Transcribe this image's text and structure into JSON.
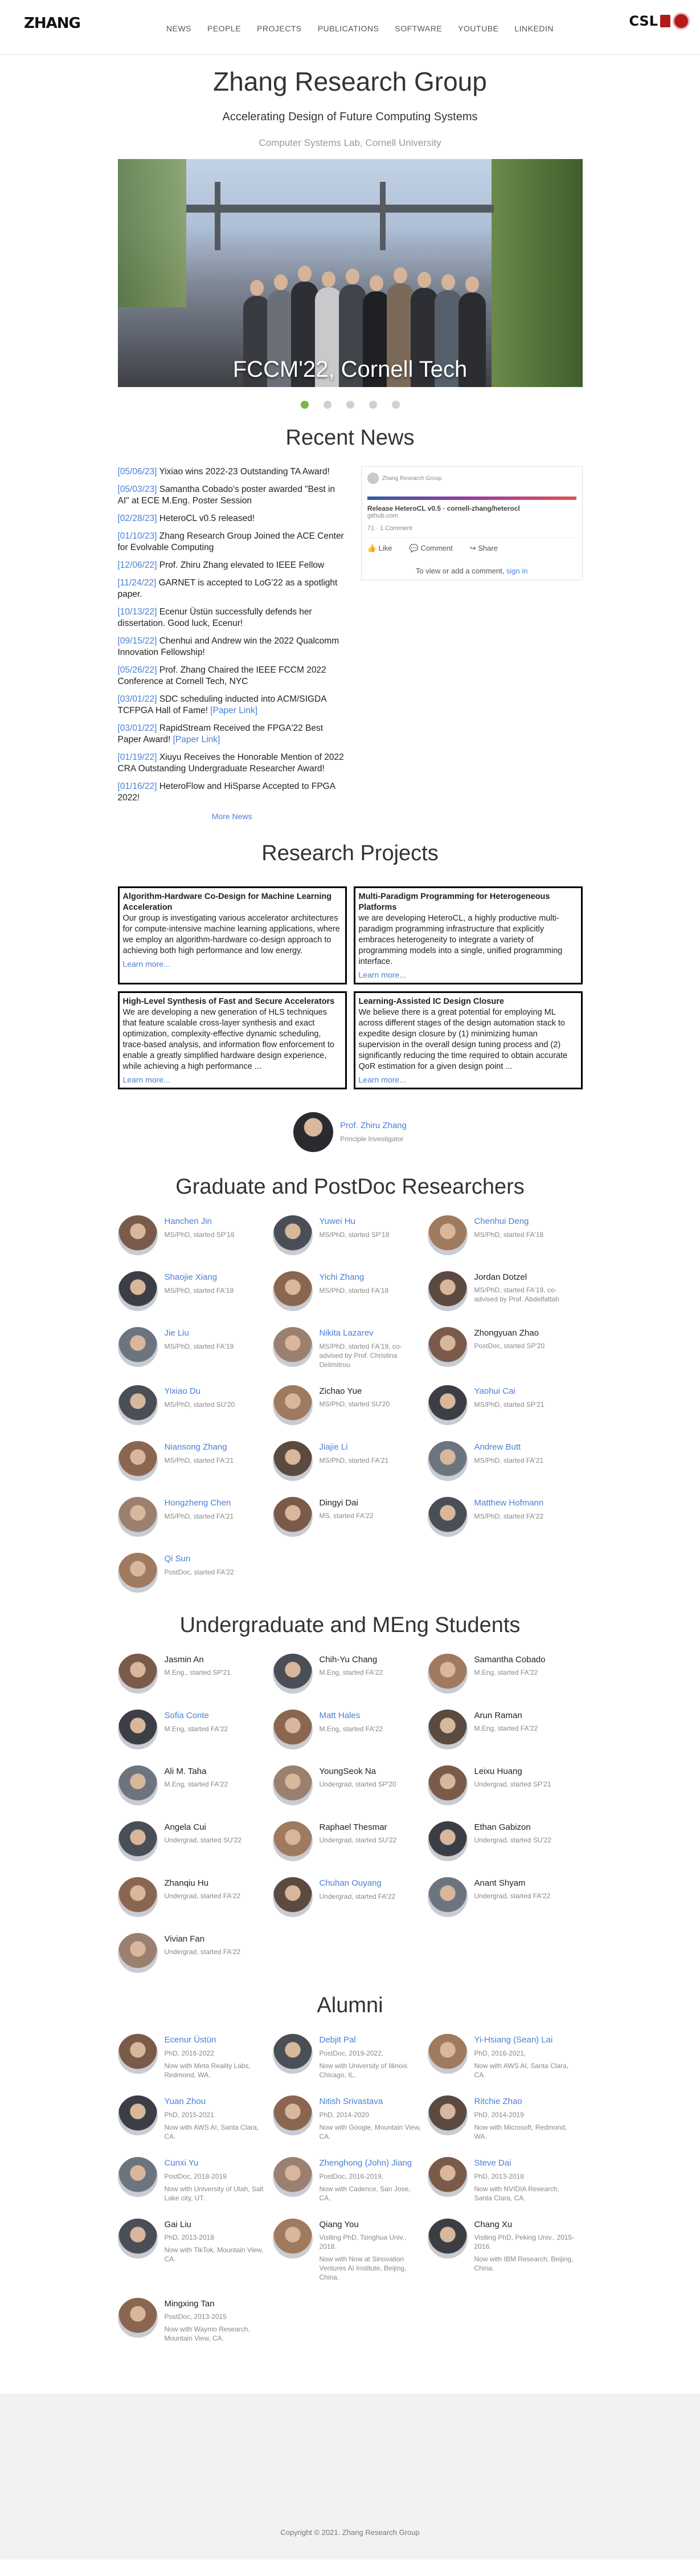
{
  "nav": {
    "logo": "ZHANG",
    "links": [
      "NEWS",
      "PEOPLE",
      "PROJECTS",
      "PUBLICATIONS",
      "SOFTWARE",
      "YOUTUBE",
      "LINKEDIN"
    ],
    "csl": "CSL"
  },
  "hero": {
    "title": "Zhang Research Group",
    "subtitle": "Accelerating Design of Future Computing Systems",
    "lab": "Computer Systems Lab, Cornell University",
    "caption": "FCCM'22, Cornell Tech",
    "slides": 5,
    "active_slide": 0
  },
  "news": {
    "title": "Recent News",
    "items": [
      {
        "date": "[05/06/23]",
        "text": " Yixiao wins 2022-23 Outstanding TA Award!"
      },
      {
        "date": "[05/03/23]",
        "text": " Samantha Cobado's poster awarded \"Best in AI\" at ECE M.Eng. Poster Session"
      },
      {
        "date": "[02/28/23]",
        "text": " HeteroCL v0.5 released!"
      },
      {
        "date": "[01/10/23]",
        "text": " Zhang Research Group Joined the ACE Center for Evolvable Computing"
      },
      {
        "date": "[12/06/22]",
        "text": " Prof. Zhiru Zhang elevated to IEEE Fellow"
      },
      {
        "date": "[11/24/22]",
        "text": " GARNET is accepted to LoG'22 as a spotlight paper."
      },
      {
        "date": "[10/13/22]",
        "text": " Ecenur Üstün successfully defends her dissertation. Good luck, Ecenur!"
      },
      {
        "date": "[09/15/22]",
        "text": " Chenhui and Andrew win the 2022 Qualcomm Innovation Fellowship!"
      },
      {
        "date": "[05/26/22]",
        "text": " Prof. Zhang Chaired the IEEE FCCM 2022 Conference at Cornell Tech, NYC"
      },
      {
        "date": "[03/01/22]",
        "text": " SDC scheduling inducted into ACM/SIGDA TCFPGA Hall of Fame! ",
        "link": "[Paper Link]"
      },
      {
        "date": "[03/01/22]",
        "text": " RapidStream Received the FPGA'22 Best Paper Award! ",
        "link": "[Paper Link]"
      },
      {
        "date": "[01/19/22]",
        "text": " Xiuyu Receives the Honorable Mention of 2022 CRA Outstanding Undergraduate Researcher Award!"
      },
      {
        "date": "[01/16/22]",
        "text": " HeteroFlow and HiSparse Accepted to FPGA 2022!"
      }
    ],
    "more": "More News",
    "linkedin": {
      "post_label": "Zhang Research Group",
      "title": "Release HeteroCL v0.5 · cornell-zhang/heterocl",
      "host": "github.com",
      "reacts": "71 · 1 Comment",
      "like": "Like",
      "comment": "Comment",
      "share": "Share",
      "foot_text": "To view or add a comment, ",
      "sign_in": "sign in"
    }
  },
  "projects": {
    "title": "Research Projects",
    "items": [
      {
        "title": "Algorithm-Hardware Co-Design for Machine Learning Acceleration",
        "body": "Our group is investigating various accelerator architectures for compute-intensive machine learning applications, where we employ an algorithm-hardware co-design approach to achieving both high performance and low energy.",
        "more": "Learn more..."
      },
      {
        "title": "Multi-Paradigm Programming for Heterogeneous Platforms",
        "body": "we are developing HeteroCL, a highly productive multi-paradigm programming infrastructure that explicitly embraces heterogeneity to integrate a variety of programming models into a single, unified programming interface.",
        "more": "Learn more..."
      },
      {
        "title": "High-Level Synthesis of Fast and Secure Accelerators",
        "body": "We are developing a new generation of HLS techniques that feature scalable cross-layer synthesis and exact optimization, complexity-effective dynamic scheduling, trace-based analysis, and information flow enforcement to enable a greatly simplified hardware design experience, while achieving a high performance ...",
        "more": "Learn more..."
      },
      {
        "title": "Learning-Assisted IC Design Closure",
        "body": "We believe there is a great potential for employing ML across different stages of the design automation stack to expedite design closure by (1) minimizing human supervision in the overall design tuning process and (2) significantly reducing the time required to obtain accurate QoR estimation for a given design point ...",
        "more": "Learn more..."
      }
    ]
  },
  "pi": {
    "name": "Prof. Zhiru Zhang",
    "role": "Principle Investigator"
  },
  "grad": {
    "title": "Graduate and PostDoc Researchers",
    "people": [
      {
        "name": "Hanchen Jin",
        "meta": "MS/PhD, started SP'18",
        "link": true
      },
      {
        "name": "Yuwei Hu",
        "meta": "MS/PhD, started SP'18",
        "link": true
      },
      {
        "name": "Chenhui Deng",
        "meta": "MS/PhD, started FA'18",
        "link": true
      },
      {
        "name": "Shaojie Xiang",
        "meta": "MS/PhD, started FA'18",
        "link": true
      },
      {
        "name": "Yichi Zhang",
        "meta": "MS/PhD, started FA'18",
        "link": true
      },
      {
        "name": "Jordan Dotzel",
        "meta": "MS/PhD, started FA'19, co-advised by Prof. Abdelfattah",
        "link": false
      },
      {
        "name": "Jie Liu",
        "meta": "MS/PhD, started FA'19",
        "link": true
      },
      {
        "name": "Nikita Lazarev",
        "meta": "MS/PhD, started FA'19, co-advised by Prof. Christina Delimitrou",
        "link": true
      },
      {
        "name": "Zhongyuan Zhao",
        "meta": "PostDoc, started SP'20",
        "link": false
      },
      {
        "name": "Yixiao Du",
        "meta": "MS/PhD, started SU'20",
        "link": true
      },
      {
        "name": "Zichao Yue",
        "meta": "MS/PhD, started SU'20",
        "link": false
      },
      {
        "name": "Yaohui Cai",
        "meta": "MS/PhD, started SP'21",
        "link": true
      },
      {
        "name": "Niansong Zhang",
        "meta": "MS/PhD, started FA'21",
        "link": true
      },
      {
        "name": "Jiajie Li",
        "meta": "MS/PhD, started FA'21",
        "link": true
      },
      {
        "name": "Andrew Butt",
        "meta": "MS/PhD, started FA'21",
        "link": true
      },
      {
        "name": "Hongzheng Chen",
        "meta": "MS/PhD, started FA'21",
        "link": true
      },
      {
        "name": "Dingyi Dai",
        "meta": "MS, started FA'22",
        "link": false
      },
      {
        "name": "Matthew Hofmann",
        "meta": "MS/PhD, started FA'22",
        "link": true
      },
      {
        "name": "Qi Sun",
        "meta": "PostDoc, started FA'22",
        "link": true
      }
    ]
  },
  "ugrad": {
    "title": "Undergraduate and MEng Students",
    "people": [
      {
        "name": "Jasmin An",
        "meta": "M.Eng., started SP'21",
        "link": false
      },
      {
        "name": "Chih-Yu Chang",
        "meta": "M.Eng, started FA'22",
        "link": false
      },
      {
        "name": "Samantha Cobado",
        "meta": "M.Eng, started FA'22",
        "link": false
      },
      {
        "name": "Sofia Conte",
        "meta": "M.Eng, started FA'22",
        "link": true
      },
      {
        "name": "Matt Hales",
        "meta": "M.Eng, started FA'22",
        "link": true
      },
      {
        "name": "Arun Raman",
        "meta": "M.Eng, started FA'22",
        "link": false
      },
      {
        "name": "Ali M. Taha",
        "meta": "M.Eng, started FA'22",
        "link": false
      },
      {
        "name": "YoungSeok Na",
        "meta": "Undergrad, started SP'20",
        "link": false
      },
      {
        "name": "Leixu Huang",
        "meta": "Undergrad, started SP'21",
        "link": false
      },
      {
        "name": "Angela Cui",
        "meta": "Undergrad, started SU'22",
        "link": false
      },
      {
        "name": "Raphael Thesmar",
        "meta": "Undergrad, started SU'22",
        "link": false
      },
      {
        "name": "Ethan Gabizon",
        "meta": "Undergrad, started SU'22",
        "link": false
      },
      {
        "name": "Zhanqiu Hu",
        "meta": "Undergrad, started FA'22",
        "link": false
      },
      {
        "name": "Chuhan Ouyang",
        "meta": "Undergrad, started FA'22",
        "link": true
      },
      {
        "name": "Anant Shyam",
        "meta": "Undergrad, started FA'22",
        "link": false
      },
      {
        "name": "Vivian Fan",
        "meta": "Undergrad, started FA'22",
        "link": false
      }
    ]
  },
  "alumni": {
    "title": "Alumni",
    "people": [
      {
        "name": "Ecenur Üstün",
        "meta": "PhD, 2016-2022",
        "meta2": "Now with Meta Reality Labs, Redmond, WA.",
        "link": true
      },
      {
        "name": "Debjit Pal",
        "meta": "PostDoc, 2019-2022,",
        "meta2": "Now with University of Illinois Chicago, IL.",
        "link": true
      },
      {
        "name": "Yi-Hsiang (Sean) Lai",
        "meta": "PhD, 2016-2021,",
        "meta2": "Now with AWS AI, Santa Clara, CA.",
        "link": true
      },
      {
        "name": "Yuan Zhou",
        "meta": "PhD, 2015-2021",
        "meta2": "Now with AWS AI, Santa Clara, CA.",
        "link": true
      },
      {
        "name": "Nitish Srivastava",
        "meta": "PhD, 2014-2020",
        "meta2": "Now with Google, Mountain View, CA.",
        "link": true
      },
      {
        "name": "Ritchie Zhao",
        "meta": "PhD, 2014-2019",
        "meta2": "Now with Microsoft, Redmond, WA.",
        "link": true
      },
      {
        "name": "Cunxi Yu",
        "meta": "PostDoc, 2018-2019",
        "meta2": "Now with University of Utah, Salt Lake city, UT.",
        "link": true
      },
      {
        "name": "Zhenghong (John) Jiang",
        "meta": "PostDoc, 2016-2019,",
        "meta2": "Now with Cadence, San Jose, CA.",
        "link": true
      },
      {
        "name": "Steve Dai",
        "meta": "PhD, 2013-2018",
        "meta2": "Now with NVIDIA Research, Santa Clara, CA.",
        "link": true
      },
      {
        "name": "Gai Liu",
        "meta": "PhD, 2013-2018",
        "meta2": "Now with TikTok, Mountain View, CA.",
        "link": false
      },
      {
        "name": "Qiang You",
        "meta": "Visiting PhD, Tsinghua Univ., 2018.",
        "meta2": "Now with Now at Sinovation Ventures AI Institute, Beijing, China.",
        "link": false
      },
      {
        "name": "Chang Xu",
        "meta": "Visiting PhD, Peking Univ., 2015-2016.",
        "meta2": "Now with IBM Research, Beijing, China.",
        "link": false
      },
      {
        "name": "Mingxing Tan",
        "meta": "PostDoc, 2013-2015",
        "meta2": "Now with Waymo Research, Mountain View, CA.",
        "link": false
      }
    ]
  },
  "footer": {
    "copyright": "Copyright © 2021. Zhang Research Group"
  },
  "colors": {
    "link": "#4a7fd6",
    "accent_dot": "#7ab648",
    "brand_red": "#b31b1b"
  }
}
